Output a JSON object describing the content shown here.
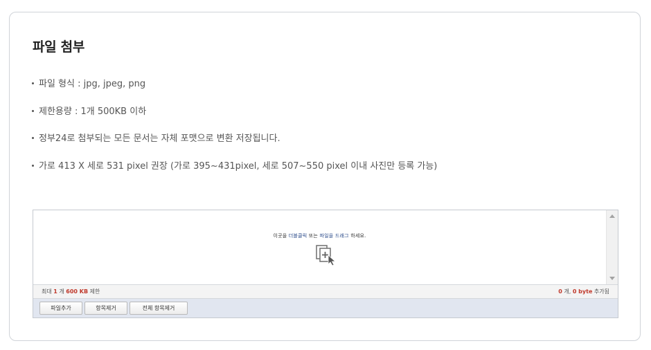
{
  "section": {
    "title": "파일 첨부"
  },
  "notes": [
    "파일 형식 : jpg, jpeg, png",
    "제한용량 : 1개 500KB 이하",
    "정부24로 첨부되는 모든 문서는 자체 포맷으로 변환 저장됩니다.",
    "가로 413 X 세로 531 pixel 권장 (가로 395~431pixel, 세로 507~550 pixel 이내 사진만 등록 가능)"
  ],
  "uploader": {
    "drop_text_1": "이곳을 ",
    "drop_text_2": "더블클릭",
    "drop_text_3": " 또는 ",
    "drop_text_4": "파일을 드래그",
    "drop_text_5": " 하세요.",
    "drop_icon": "add-file-icon",
    "status": {
      "max_label": "최대 ",
      "max_count": "1",
      "count_unit": " 개 ",
      "max_size": "600 KB",
      "limit_label": " 제한",
      "current_count": "0",
      "current_unit": " 개, ",
      "current_size": "0 byte",
      "added_label": " 추가됨"
    },
    "buttons": {
      "add": "파일추가",
      "remove": "항목제거",
      "remove_all": "전체 항목제거"
    }
  }
}
